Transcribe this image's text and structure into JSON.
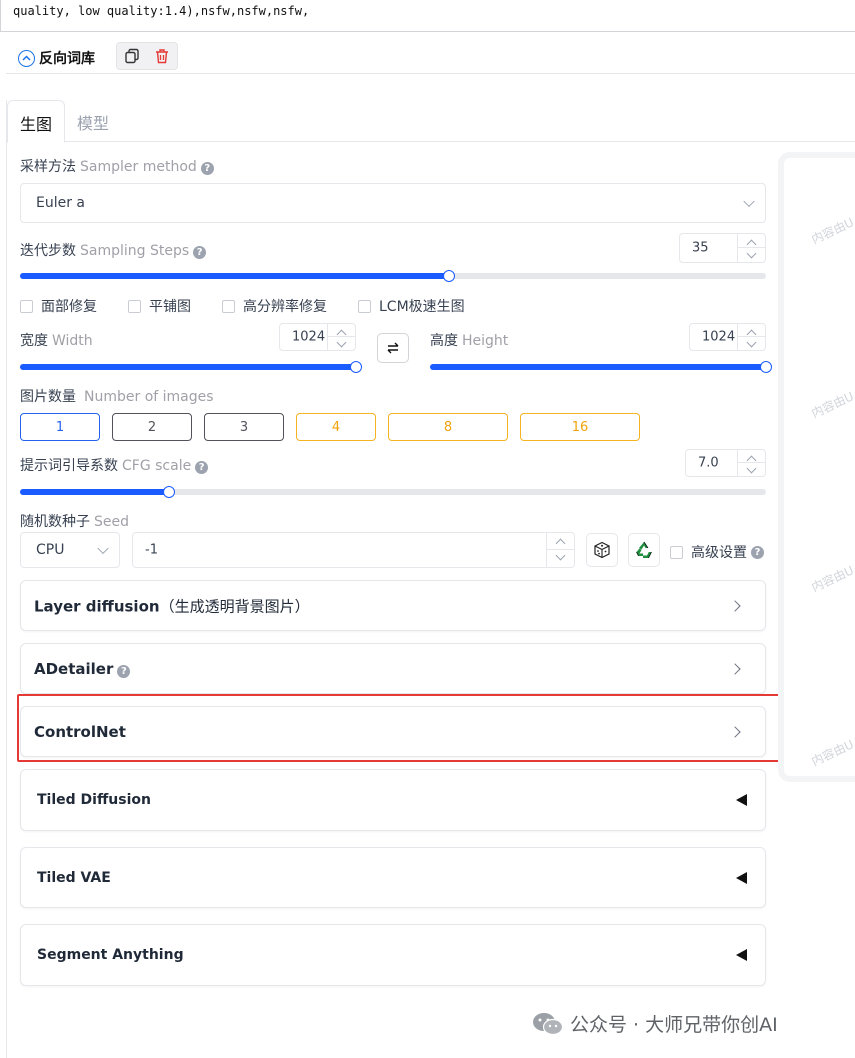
{
  "prompt": {
    "text": "quality, low quality:1.4),nsfw,nsfw,nsfw,"
  },
  "reverse_prompt": {
    "label": "反向词库"
  },
  "tabs": [
    {
      "label": "生图"
    },
    {
      "label": "模型"
    }
  ],
  "sampler": {
    "label": "采样方法",
    "label_en": "Sampler method",
    "value": "Euler a"
  },
  "steps": {
    "label": "迭代步数",
    "label_en": "Sampling Steps",
    "value": "35",
    "fraction": 0.575
  },
  "options": [
    {
      "label": "面部修复"
    },
    {
      "label": "平铺图"
    },
    {
      "label": "高分辨率修复"
    },
    {
      "label": "LCM极速生图"
    }
  ],
  "width": {
    "label": "宽度",
    "label_en": "Width",
    "value": "1024",
    "fraction": 1.0
  },
  "height": {
    "label": "高度",
    "label_en": "Height",
    "value": "1024",
    "fraction": 1.0
  },
  "image_count": {
    "label": "图片数量",
    "label_en": "Number of images",
    "options": [
      "1",
      "2",
      "3",
      "4",
      "8",
      "16"
    ],
    "selected": "1"
  },
  "cfg": {
    "label": "提示词引导系数",
    "label_en": "CFG scale",
    "value": "7.0",
    "fraction": 0.2
  },
  "seed": {
    "label": "随机数种子",
    "label_en": "Seed",
    "device": "CPU",
    "value": "-1",
    "advanced_label": "高级设置"
  },
  "accordions": {
    "layer_diffusion": {
      "title": "Layer diffusion",
      "subtitle": "（生成透明背景图片）"
    },
    "adetailer": {
      "title": "ADetailer"
    },
    "controlnet": {
      "title": "ControlNet"
    },
    "tiled_diffusion": {
      "title": "Tiled Diffusion"
    },
    "tiled_vae": {
      "title": "Tiled VAE"
    },
    "segment_anything": {
      "title": "Segment Anything"
    }
  },
  "watermark": {
    "text": "内容由U"
  },
  "footer": {
    "text": "公众号 · 大师兄带你创AI"
  },
  "colors": {
    "accent": "#1a5cff",
    "highlight": "#e53935",
    "warning": "#f5b324"
  }
}
